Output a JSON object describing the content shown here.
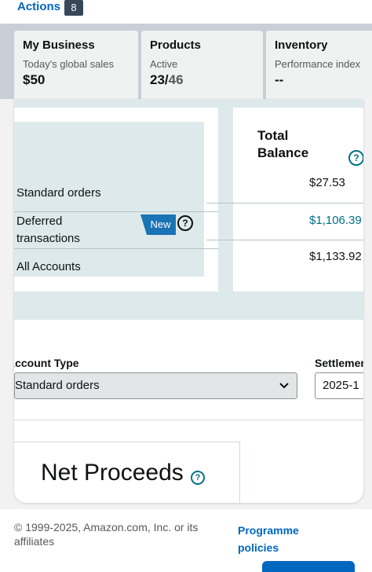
{
  "actions": {
    "label": "Actions",
    "count": "8"
  },
  "cards": [
    {
      "title": "My Business",
      "sub": "Today's global sales",
      "value": "$50"
    },
    {
      "title": "Products",
      "sub": "Active",
      "value_active": "23",
      "value_sep": "/",
      "value_total": "46"
    },
    {
      "title": "Inventory",
      "sub": "Performance index",
      "value": "--"
    }
  ],
  "balances": {
    "rows": [
      {
        "label": "Standard orders",
        "amount": "$27.53"
      },
      {
        "label_line1": "Deferred",
        "label_line2": "transactions",
        "badge": "New",
        "amount": "$1,106.39"
      },
      {
        "label": "All Accounts",
        "amount": "$1,133.92"
      }
    ],
    "total_title_line1": "Total",
    "total_title_line2": "Balance",
    "help_glyph": "?",
    "colors": {
      "deferred_amount": "#007185",
      "badge_bg": "#1a73b5"
    }
  },
  "filters": {
    "account_type_label": "Account Type",
    "account_type_value": "Standard orders",
    "settlement_label": "Settlement",
    "settlement_value": "2025-1"
  },
  "net_proceeds": {
    "title": "Net Proceeds"
  },
  "footer": {
    "copyright": "© 1999-2025, Amazon.com, Inc. or its affiliates",
    "policies": "Programme policies"
  },
  "icons": [
    "help-icon",
    "chevron-down-icon"
  ]
}
